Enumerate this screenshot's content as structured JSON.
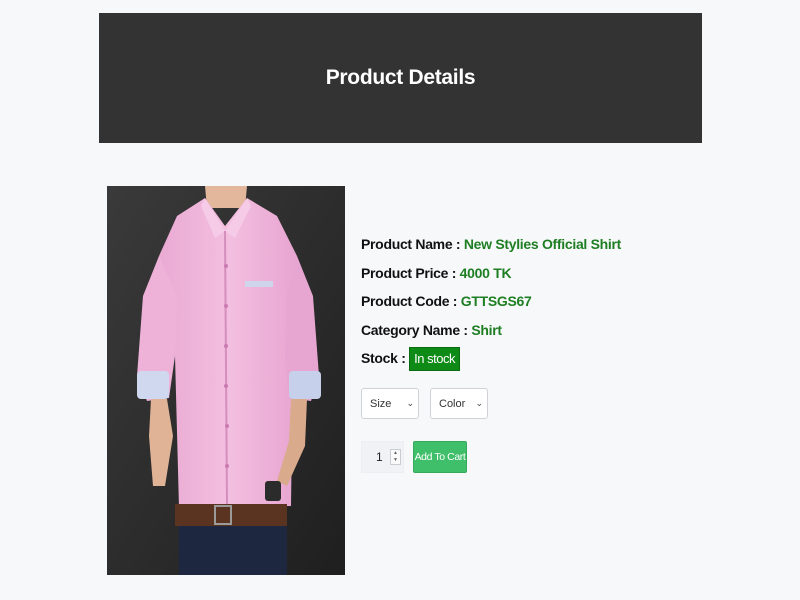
{
  "header": {
    "title": "Product Details"
  },
  "product": {
    "image_alt": "pink-shirt-photo",
    "fields": [
      {
        "label": "Product Name : ",
        "value": "New Stylies Official Shirt"
      },
      {
        "label": "Product Price : ",
        "value": "4000 TK"
      },
      {
        "label": "Product Code : ",
        "value": "GTTSGS67"
      },
      {
        "label": "Category Name : ",
        "value": "Shirt"
      }
    ],
    "stock": {
      "label": "Stock : ",
      "value": "In stock",
      "badge_color": "#0e8a16"
    }
  },
  "options": {
    "size": {
      "selected": "Size"
    },
    "color": {
      "selected": "Color"
    }
  },
  "cart": {
    "quantity": "1",
    "add_label": "Add To Cart",
    "button_color": "#3fbf6a"
  },
  "colors": {
    "header_bg": "#333333",
    "value_green": "#1e7e22",
    "page_bg": "#f7f8fa"
  }
}
